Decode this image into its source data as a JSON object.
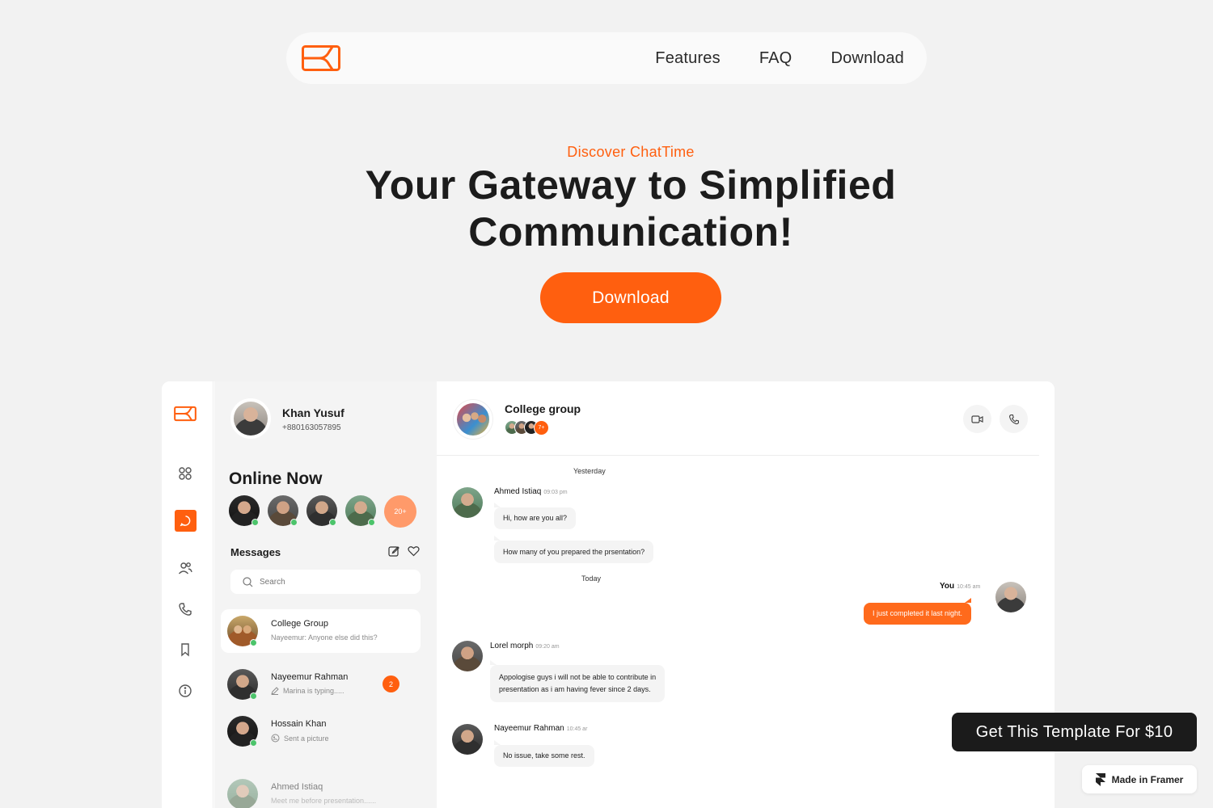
{
  "nav": {
    "links": [
      "Features",
      "FAQ",
      "Download"
    ]
  },
  "hero": {
    "eyebrow": "Discover ChatTime",
    "headline_line1": "Your Gateway to Simplified",
    "headline_line2": "Communication!",
    "cta": "Download"
  },
  "app": {
    "profile": {
      "name": "Khan Yusuf",
      "phone": "+880163057895"
    },
    "online": {
      "title": "Online Now",
      "more": "20+"
    },
    "messages": {
      "title": "Messages",
      "search_placeholder": "Search",
      "conversations": [
        {
          "name": "College Group",
          "preview": "Nayeemur: Anyone else did this?",
          "badge": ""
        },
        {
          "name": "Nayeemur Rahman",
          "preview": "Marina is typing.....",
          "badge": "2"
        },
        {
          "name": "Hossain Khan",
          "preview": "Sent a picture",
          "badge": ""
        },
        {
          "name": "Ahmed Istiaq",
          "preview": "Meet me before presentation......",
          "badge": ""
        }
      ]
    },
    "chat": {
      "title": "College group",
      "members_more": "7+",
      "day_yesterday": "Yesterday",
      "day_today": "Today",
      "messages": [
        {
          "sender": "Ahmed Istiaq",
          "time": "09:03 pm",
          "texts": [
            "Hi, how are you all?",
            "How many of you prepared the prsentation?"
          ]
        },
        {
          "sender": "You",
          "time": "10:45 am",
          "texts": [
            "I just completed it last night."
          ]
        },
        {
          "sender": "Lorel morph",
          "time": "09:20 am",
          "texts": [
            "Appologise guys i will not be able to contribute in",
            "presentation as i am having fever since 2 days."
          ]
        },
        {
          "sender": "Nayeemur Rahman",
          "time": "10:45 ar",
          "texts": [
            "No issue, take some rest."
          ]
        }
      ]
    }
  },
  "floating": {
    "template_cta": "Get This Template For $10",
    "framer": "Made in Framer"
  },
  "colors": {
    "accent": "#ff5f0f",
    "background": "#f2f2f2",
    "online": "#4cc46b"
  },
  "icons": [
    "logo-icon",
    "grid-icon",
    "chat-icon",
    "users-icon",
    "phone-icon",
    "bookmark-icon",
    "info-icon",
    "edit-icon",
    "heart-icon",
    "search-icon",
    "pencil-icon",
    "image-icon",
    "video-icon",
    "framer-icon"
  ]
}
